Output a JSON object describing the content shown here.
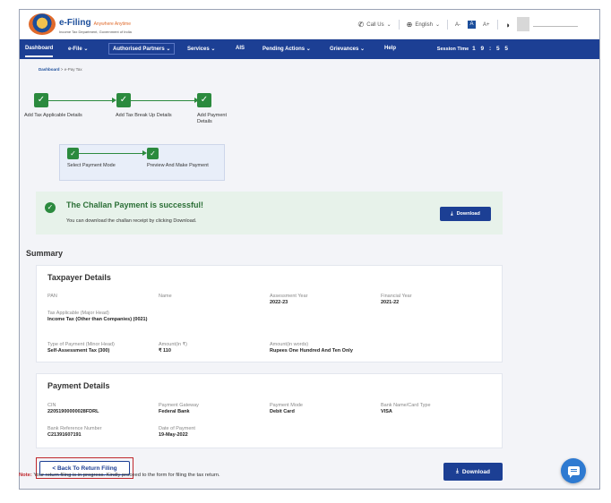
{
  "header": {
    "logo_title": "e-Filing",
    "logo_tagline": "Anywhere Anytime",
    "logo_subtitle": "Income Tax Department, Government of India",
    "call_us": "Call Us",
    "language": "English",
    "font_increase": "A+",
    "font_normal": "A",
    "font_decrease": "A-"
  },
  "nav": {
    "items": [
      "Dashboard",
      "e-File",
      "Authorised Partners",
      "Services",
      "AIS",
      "Pending Actions",
      "Grievances",
      "Help"
    ],
    "session_label": "Session Time",
    "session_value": "1 9 : 5 5"
  },
  "breadcrumb": {
    "home": "Dashboard",
    "sep": ">",
    "current": "e-Pay Tax"
  },
  "steps": [
    "Add Tax Applicable Details",
    "Add Tax Break Up Details",
    "Add Payment Details"
  ],
  "substeps": [
    "Select Payment Mode",
    "Preview And Make Payment"
  ],
  "success": {
    "title": "The Challan Payment is successful!",
    "subtitle": "You can download the challan receipt by clicking Download.",
    "download": "Download"
  },
  "summary_title": "Summary",
  "taxpayer": {
    "title": "Taxpayer Details",
    "pan_label": "PAN",
    "name_label": "Name",
    "ay_label": "Assessment Year",
    "ay_value": "2022-23",
    "fy_label": "Financial Year",
    "fy_value": "2021-22",
    "major_label": "Tax Applicable (Major Head)",
    "major_value": "Income Tax (Other than Companies) (0021)",
    "minor_label": "Type of Payment (Minor Head)",
    "minor_value": "Self-Assessment Tax (300)",
    "amount_label": "Amount(in ₹)",
    "amount_value": "₹ 110",
    "words_label": "Amount(in words)",
    "words_value": "Rupees One Hundred And Ten Only"
  },
  "payment": {
    "title": "Payment Details",
    "cin_label": "CIN",
    "cin_value": "22051900000028FDRL",
    "gateway_label": "Payment Gateway",
    "gateway_value": "Federal Bank",
    "mode_label": "Payment Mode",
    "mode_value": "Debit Card",
    "bank_label": "Bank Name/Card Type",
    "bank_value": "VISA",
    "ref_label": "Bank Reference Number",
    "ref_value": "C21391607191",
    "date_label": "Date of Payment",
    "date_value": "19-May-2022"
  },
  "back_button": "< Back To Return Filing",
  "download_button": "Download",
  "note_prefix": "Note:",
  "note_text": "Your return filing is in progress. Kindly proceed to the form for filing the tax return.",
  "icons": [
    "phone-icon",
    "globe-icon",
    "contrast-icon",
    "check-icon",
    "download-icon",
    "chat-icon"
  ]
}
